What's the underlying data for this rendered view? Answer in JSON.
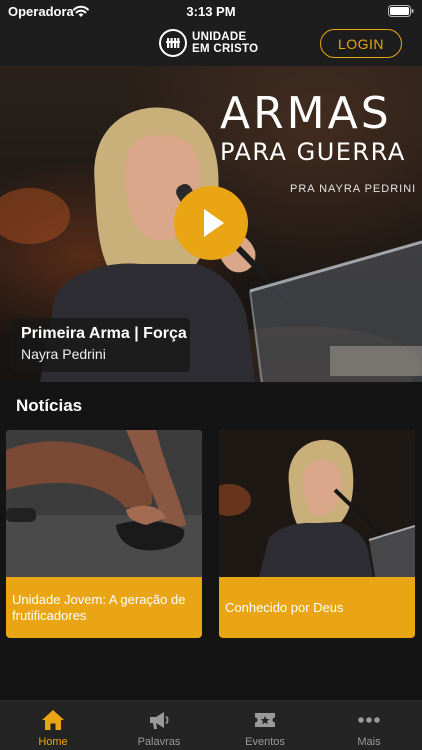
{
  "status_bar": {
    "carrier": "Operadora",
    "time": "3:13 PM"
  },
  "header": {
    "logo_line1": "UNIDADE",
    "logo_line2": "EM CRISTO",
    "login_label": "LOGIN"
  },
  "hero": {
    "title_line1": "ARMAS",
    "title_line2": "PARA GUERRA",
    "speaker_banner": "PRA NAYRA PEDRINI",
    "caption_title": "Primeira Arma | Força",
    "caption_subtitle": "Nayra Pedrini"
  },
  "news": {
    "section_title": "Notícias",
    "cards": [
      {
        "caption": "Unidade Jovem: A geração de frutificadores"
      },
      {
        "caption": "Conhecido por Deus"
      }
    ]
  },
  "tab_bar": {
    "tabs": [
      {
        "label": "Home",
        "icon": "home-icon",
        "active": true
      },
      {
        "label": "Palavras",
        "icon": "megaphone-icon",
        "active": false
      },
      {
        "label": "Eventos",
        "icon": "ticket-icon",
        "active": false
      },
      {
        "label": "Mais",
        "icon": "more-dots-icon",
        "active": false
      }
    ]
  },
  "colors": {
    "accent": "#e9a514",
    "background": "#141414",
    "header": "#1d1d1d",
    "tab_bar": "#242424",
    "inactive_tab": "#9a9a9a"
  }
}
